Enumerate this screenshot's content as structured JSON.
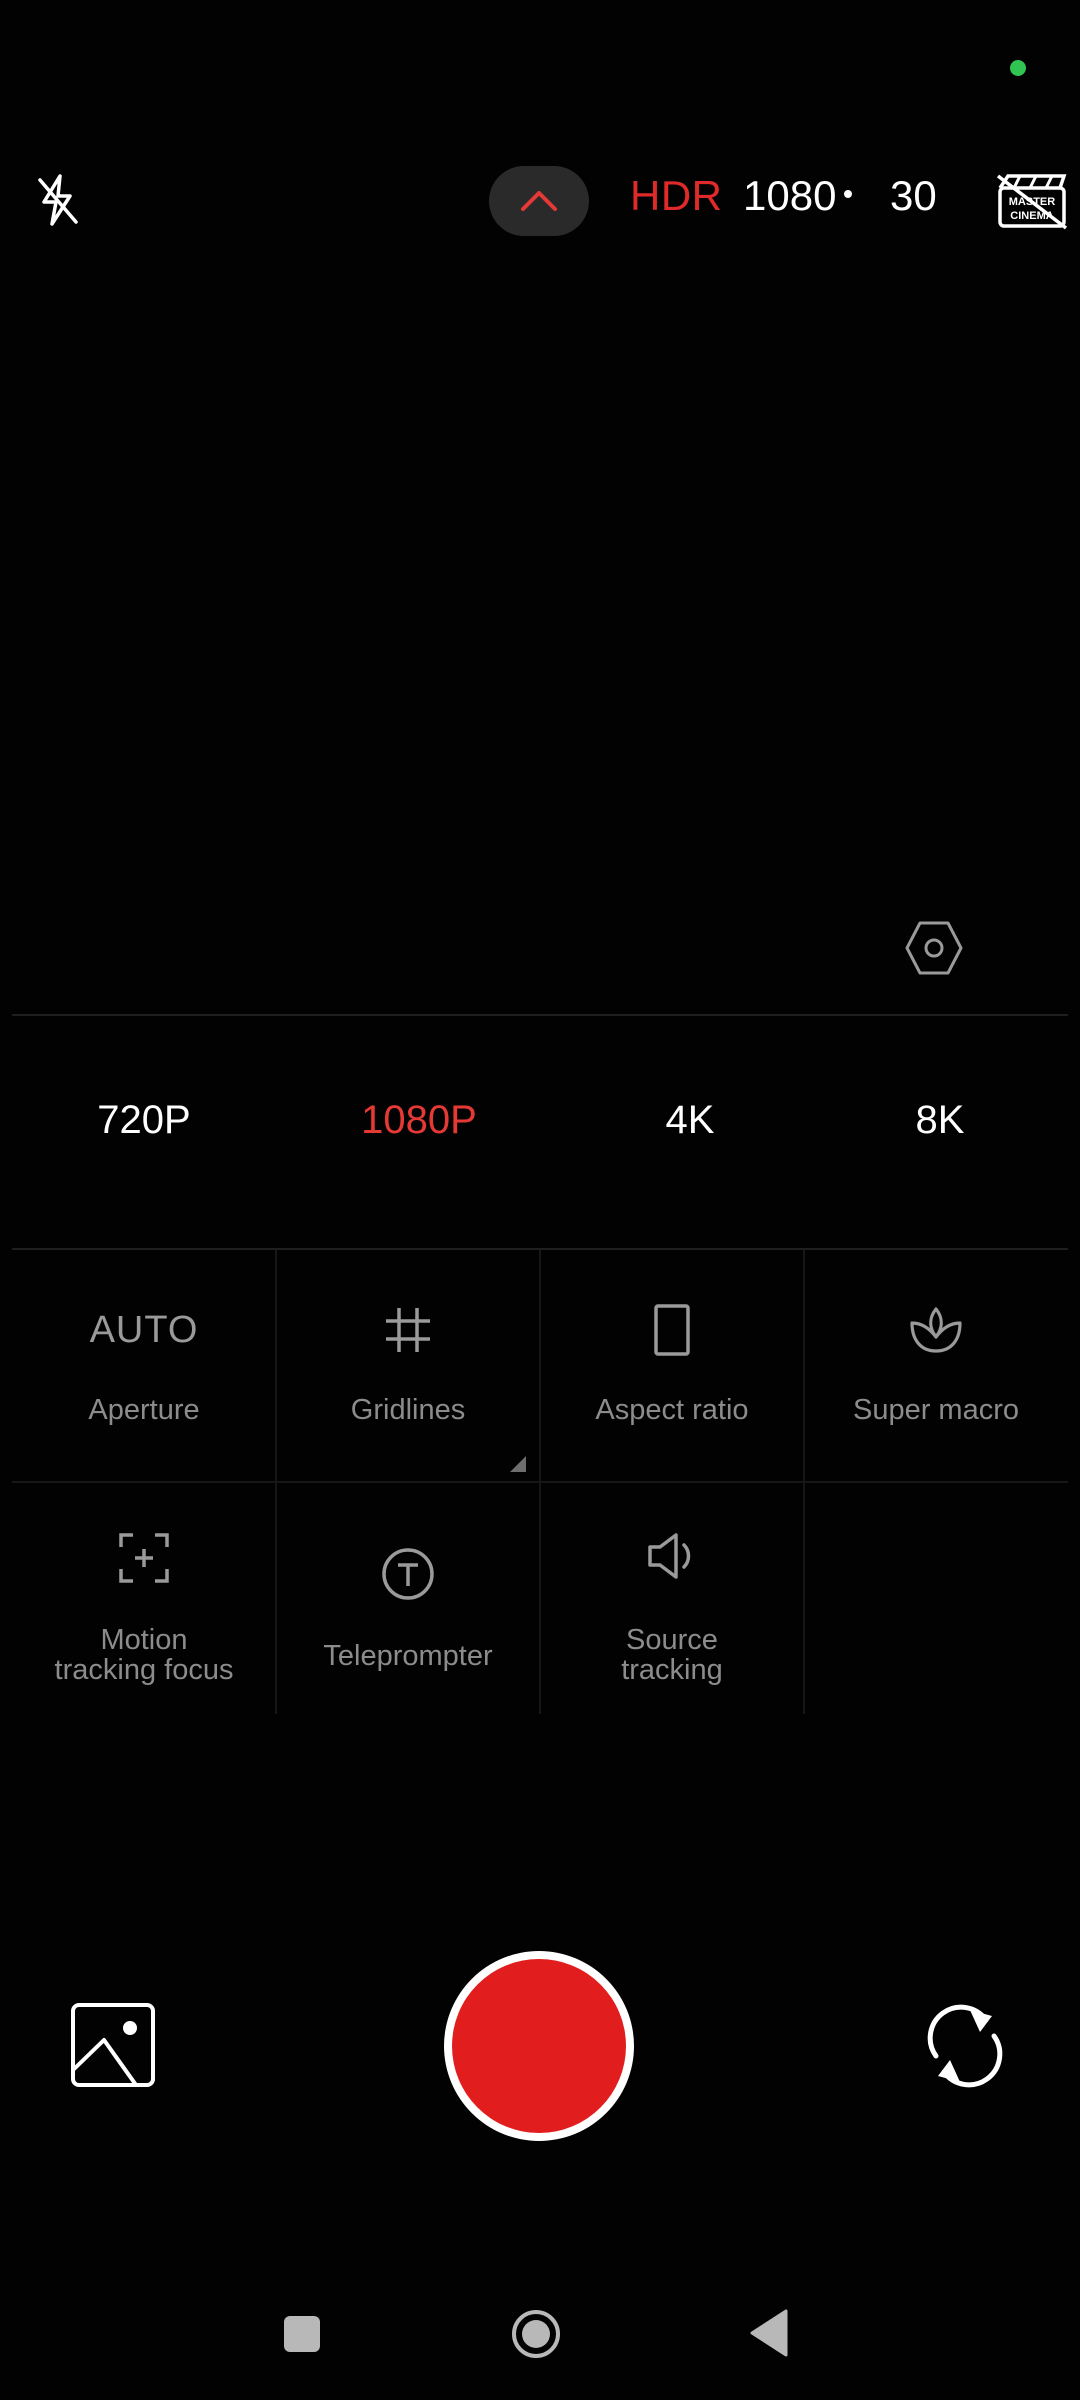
{
  "colors": {
    "accent_red": "#e53935",
    "status_green": "#30c552"
  },
  "top_bar": {
    "flash_icon": "flash-off-icon",
    "expand_icon": "chevron-up-icon",
    "hdr_label": "HDR",
    "resolution": "1080",
    "fps": "30",
    "cinema_icon": "master-cinema-off-icon",
    "cinema_label_1": "MASTER",
    "cinema_label_2": "CINEMA"
  },
  "resolutions": {
    "options": [
      "720P",
      "1080P",
      "4K",
      "8K"
    ],
    "selected": "1080P"
  },
  "tools": [
    {
      "label": "Aperture",
      "value": "AUTO"
    },
    {
      "label": "Gridlines",
      "icon": "grid-icon"
    },
    {
      "label": "Aspect ratio",
      "icon": "aspect-ratio-icon"
    },
    {
      "label": "Super macro",
      "icon": "macro-flower-icon"
    },
    {
      "label_line1": "Motion",
      "label_line2": "tracking focus",
      "icon": "focus-tracking-icon"
    },
    {
      "label": "Teleprompter",
      "icon": "teleprompter-icon"
    },
    {
      "label_line1": "Source",
      "label_line2": "tracking",
      "icon": "speaker-icon"
    }
  ]
}
